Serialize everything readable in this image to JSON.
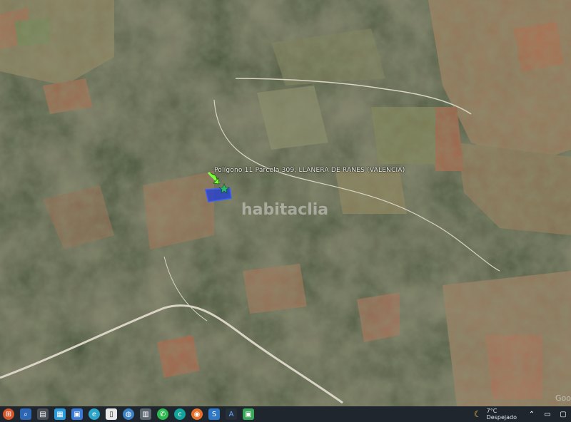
{
  "map": {
    "placemark_label": "Polígono 11 Parcela 309, LLANERA DE RANES (VALENCIA)",
    "watermark": "habitaclia",
    "corner_mark": "Goo"
  },
  "taskbar": {
    "apps": [
      {
        "name": "start",
        "glyph": "⊞"
      },
      {
        "name": "search",
        "glyph": "⌕"
      },
      {
        "name": "file-explorer",
        "glyph": "▤"
      },
      {
        "name": "store",
        "glyph": "▦"
      },
      {
        "name": "photos",
        "glyph": "▣"
      },
      {
        "name": "edge",
        "glyph": "e"
      },
      {
        "name": "document",
        "glyph": "▯"
      },
      {
        "name": "earth",
        "glyph": "◍"
      },
      {
        "name": "files",
        "glyph": "▥"
      },
      {
        "name": "whatsapp",
        "glyph": "✆"
      },
      {
        "name": "browser",
        "glyph": "c"
      },
      {
        "name": "firefox",
        "glyph": "◉"
      },
      {
        "name": "app-s",
        "glyph": "S"
      },
      {
        "name": "app-a",
        "glyph": "A"
      },
      {
        "name": "app-green",
        "glyph": "▣"
      }
    ],
    "weather_temp": "7°C",
    "weather_desc": "Despejado",
    "weather_icon": "moon-icon"
  }
}
